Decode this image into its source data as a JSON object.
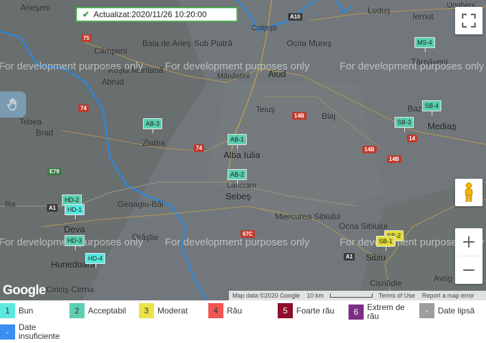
{
  "status": {
    "text": "Actualizat:2020/11/26 10:20:00",
    "icon": "check-icon"
  },
  "watermark_text": "For development purposes only",
  "places": {
    "arieseni": "Arieşeni",
    "campeni": "Câmpeni",
    "baia_de_aries": "Baia de Arieş",
    "sub_piatra": "Sub Piatră",
    "rosia_montana": "Roşia Montană",
    "abrud": "Abrud",
    "manastirii": "Mănăstirii",
    "aiud": "Aiud",
    "ocna_mures": "Ocna Mureş",
    "coltesti": "Colţeşti",
    "ludus": "Luduş",
    "iernut": "Iernut",
    "ungheni": "Ungheni",
    "tarnaveni": "Târnăveni",
    "tebea": "Tebea",
    "brad": "Brad",
    "zlatna": "Zlatna",
    "teius": "Teiuş",
    "blaj": "Blaj",
    "baz": "Baz",
    "medias": "Mediaş",
    "alba_iulia": "Alba Iulia",
    "lancram": "Lancram",
    "sebes": "Sebeş",
    "ilia": "Ilia",
    "geoagiu_bai": "Geoagiu-Băi",
    "deva": "Deva",
    "orastie": "Orăştie",
    "hunedoara": "Hunedoara",
    "miercurea_sibiului": "Miercurea Sibiului",
    "ocna_sibiului": "Ocna Sibiului",
    "sibiu": "Sibiu",
    "cincis_cerna": "Cinciş-Cerna",
    "cisnadie": "Cisnădie",
    "avrig": "Avrig"
  },
  "roads": {
    "a10": "A10",
    "r75": "75",
    "r74a": "74",
    "r74b": "74",
    "r14b": "14B",
    "r14ba": "14B",
    "r14": "14",
    "e79": "E79",
    "a1a": "A1",
    "r67c": "67C",
    "a1b": "A1",
    "r14bb": "14B"
  },
  "stations": [
    {
      "id": "AB-3",
      "color": "#5ccfb0"
    },
    {
      "id": "AB-1",
      "color": "#5ccfb0"
    },
    {
      "id": "AB-2",
      "color": "#5ccfb0"
    },
    {
      "id": "MS-4",
      "color": "#5ccfb0"
    },
    {
      "id": "SB-4",
      "color": "#5ccfb0"
    },
    {
      "id": "SB-3",
      "color": "#5ccfb0"
    },
    {
      "id": "HD-2",
      "color": "#5ccfb0"
    },
    {
      "id": "HD-1",
      "color": "#59e8e0"
    },
    {
      "id": "HD-3",
      "color": "#5ccfb0"
    },
    {
      "id": "HD-4",
      "color": "#59e8e0"
    },
    {
      "id": "SB-2",
      "color": "#e6dc3a"
    },
    {
      "id": "SB-1",
      "color": "#e6dc3a"
    }
  ],
  "attribution": {
    "map_data": "Map data ©2020 Google",
    "scale": "10 km",
    "terms": "Terms of Use",
    "report": "Report a map error"
  },
  "google_logo": "Google",
  "legend": [
    {
      "num": "1",
      "label": "Bun",
      "color": "#5ee8e0"
    },
    {
      "num": "2",
      "label": "Acceptabil",
      "color": "#5ccfb0"
    },
    {
      "num": "3",
      "label": "Moderat",
      "color": "#ece24a"
    },
    {
      "num": "4",
      "label": "Rău",
      "color": "#f25555"
    },
    {
      "num": "5",
      "label": "Foarte rău",
      "color": "#8e0e2c"
    },
    {
      "num": "6",
      "label": "Extrem de rău",
      "color": "#7b2f86"
    },
    {
      "num": "-",
      "label": "Date lipsă",
      "color": "#9e9e9e"
    },
    {
      "num": "-",
      "label": "Date insuficiente",
      "color": "#3b8ff0"
    }
  ]
}
